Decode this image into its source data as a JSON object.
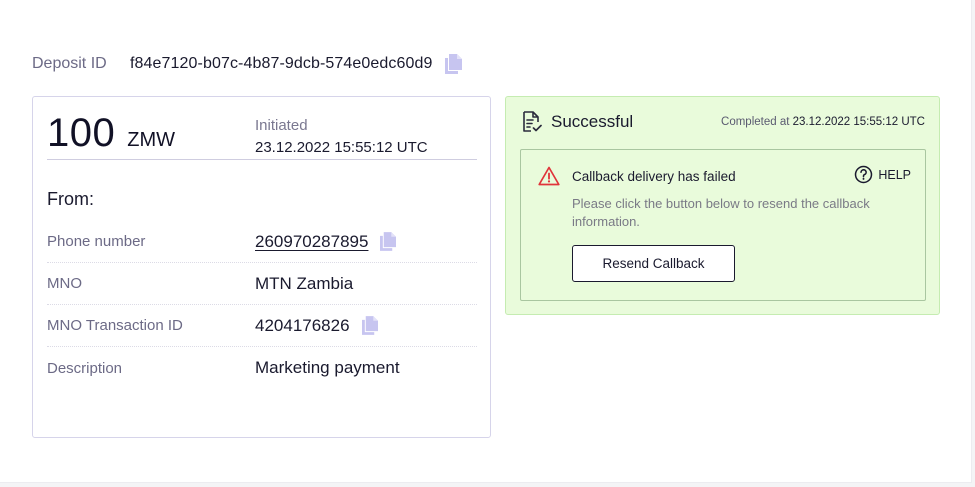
{
  "deposit": {
    "label": "Deposit ID",
    "id": "f84e7120-b07c-4b87-9dcb-574e0edc60d9"
  },
  "summary": {
    "amount": "100",
    "currency": "ZMW",
    "status_label": "Initiated",
    "status_date": "23.12.2022 15:55:12 UTC"
  },
  "from": {
    "title": "From:",
    "rows": [
      {
        "key": "Phone number",
        "value": "260970287895"
      },
      {
        "key": "MNO",
        "value": "MTN Zambia"
      },
      {
        "key": "MNO Transaction ID",
        "value": "4204176826"
      },
      {
        "key": "Description",
        "value": "Marketing payment"
      }
    ]
  },
  "result": {
    "status": "Successful",
    "completed_label": "Completed at",
    "completed_at": "23.12.2022 15:55:12 UTC",
    "alert": {
      "title": "Callback delivery has failed",
      "help_label": "HELP",
      "description": "Please click the button below to resend the callback information.",
      "button_label": "Resend Callback"
    }
  },
  "icons": {
    "copy": "copy-icon",
    "document": "document-check-icon",
    "warning": "warning-triangle-icon",
    "help": "question-circle-icon"
  },
  "colors": {
    "accent_copy": "#c7c5f0",
    "success_bg": "#e9fbdb",
    "success_border": "#c5ecb1",
    "warning": "#e0343a"
  }
}
